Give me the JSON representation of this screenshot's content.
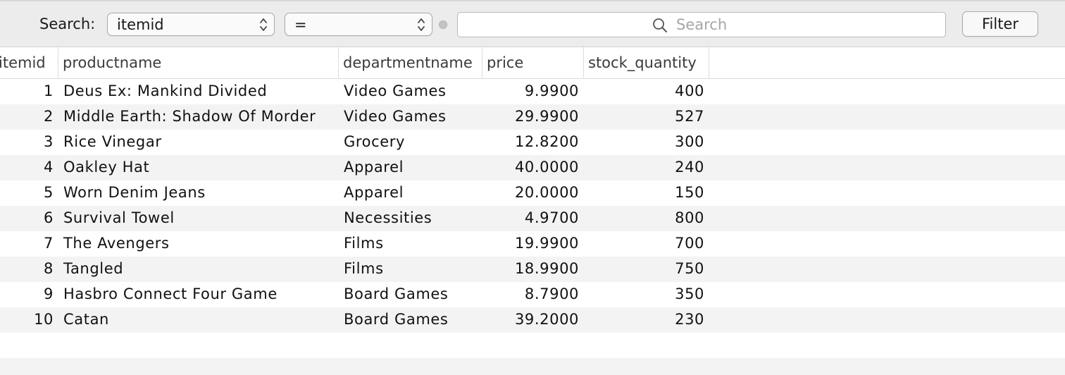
{
  "filter_bar": {
    "search_label": "Search:",
    "column_select": {
      "value": "itemid",
      "icon": "updown-chevron-icon"
    },
    "operator_select": {
      "value": "=",
      "icon": "updown-chevron-icon"
    },
    "search_field": {
      "placeholder": "Search",
      "value": "",
      "icon": "magnifier-icon"
    },
    "filter_button": "Filter"
  },
  "table": {
    "columns": [
      "itemid",
      "productname",
      "departmentname",
      "price",
      "stock_quantity"
    ],
    "rows": [
      [
        "1",
        "Deus Ex: Mankind Divided",
        "Video Games",
        "9.9900",
        "400"
      ],
      [
        "2",
        "Middle Earth: Shadow Of Morder",
        "Video Games",
        "29.9900",
        "527"
      ],
      [
        "3",
        "Rice Vinegar",
        "Grocery",
        "12.8200",
        "300"
      ],
      [
        "4",
        "Oakley Hat",
        "Apparel",
        "40.0000",
        "240"
      ],
      [
        "5",
        "Worn Denim Jeans",
        "Apparel",
        "20.0000",
        "150"
      ],
      [
        "6",
        "Survival Towel",
        "Necessities",
        "4.9700",
        "800"
      ],
      [
        "7",
        "The Avengers",
        "Films",
        "19.9900",
        "700"
      ],
      [
        "8",
        "Tangled",
        "Films",
        "18.9900",
        "750"
      ],
      [
        "9",
        "Hasbro Connect Four Game",
        "Board Games",
        "8.7900",
        "350"
      ],
      [
        "10",
        "Catan",
        "Board Games",
        "39.2000",
        "230"
      ]
    ]
  }
}
